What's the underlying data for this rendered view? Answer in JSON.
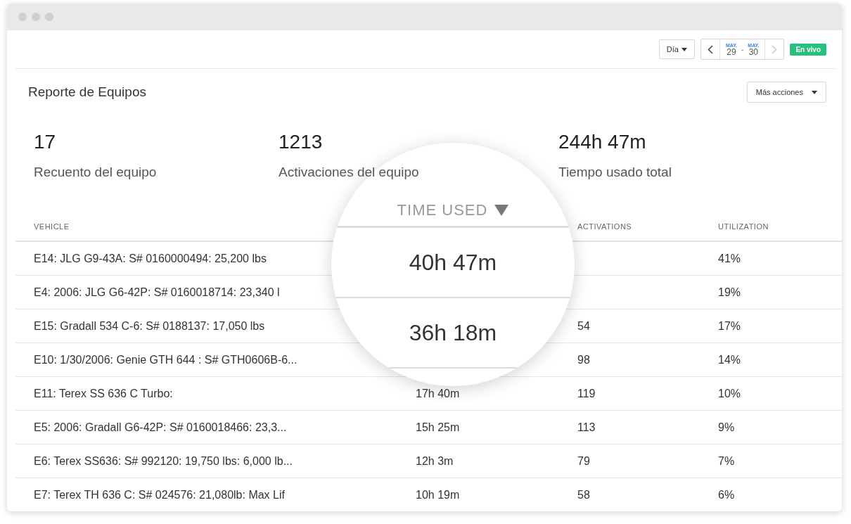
{
  "toolbar": {
    "period": "Día",
    "date_nav": {
      "prev_disabled": false,
      "next_disabled": true,
      "from": {
        "month": "MAY.",
        "day": "29"
      },
      "separator": "-",
      "to": {
        "month": "MAY.",
        "day": "30"
      }
    },
    "live_badge": "En vivo"
  },
  "report": {
    "title": "Reporte de Equipos",
    "actions_button": "Más acciones"
  },
  "stats": [
    {
      "value": "17",
      "label": "Recuento del equipo"
    },
    {
      "value": "1213",
      "label": "Activaciones del equipo"
    },
    {
      "value": "244h 47m",
      "label": "Tiempo usado total"
    }
  ],
  "table": {
    "columns": [
      "VEHICLE",
      null,
      "ACTIVATIONS",
      "UTILIZATION"
    ],
    "rows": [
      {
        "vehicle": "E14: JLG G9-43A: S# 0160000494: 25,200 lbs",
        "time_used": null,
        "activations": null,
        "utilization": "41%"
      },
      {
        "vehicle": "E4: 2006: JLG G6-42P: S# 0160018714: 23,340 l",
        "time_used": null,
        "activations": null,
        "utilization": "19%"
      },
      {
        "vehicle": "E15: Gradall 534 C-6: S# 0188137: 17,050 lbs",
        "time_used": null,
        "activations": "54",
        "utilization": "17%"
      },
      {
        "vehicle": "E10: 1/30/2006: Genie GTH 644 : S# GTH0606B-6...",
        "time_used": null,
        "activations": "98",
        "utilization": "14%"
      },
      {
        "vehicle": "E11: Terex SS 636 C Turbo:",
        "time_used": "17h 40m",
        "activations": "119",
        "utilization": "10%"
      },
      {
        "vehicle": "E5: 2006: Gradall G6-42P: S# 0160018466: 23,3...",
        "time_used": "15h 25m",
        "activations": "113",
        "utilization": "9%"
      },
      {
        "vehicle": "E6: Terex SS636: S# 992120: 19,750 lbs: 6,000 lb...",
        "time_used": "12h 3m",
        "activations": "79",
        "utilization": "7%"
      },
      {
        "vehicle": "E7: Terex TH 636 C: S# 024576: 21,080lb: Max Lif",
        "time_used": "10h 19m",
        "activations": "58",
        "utilization": "6%"
      }
    ]
  },
  "magnifier": {
    "header": "TIME USED",
    "sort_descending": true,
    "values": [
      "40h 47m",
      "36h 18m"
    ]
  }
}
